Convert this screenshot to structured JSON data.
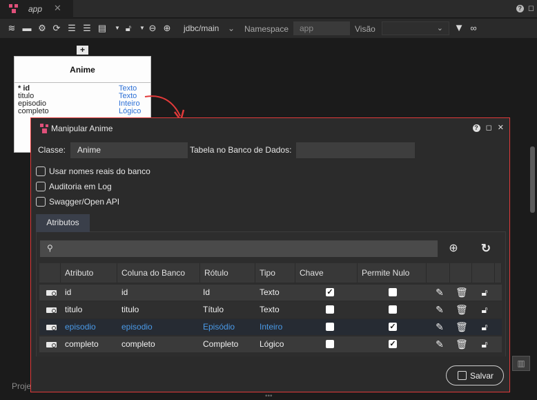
{
  "tab": {
    "label": "app",
    "close": "✕"
  },
  "topright": {
    "help": "?",
    "restore": "◻"
  },
  "toolbar": {
    "connection": "jdbc/main",
    "namespace_label": "Namespace",
    "namespace_value": "app",
    "visao_label": "Visão",
    "visao_value": ""
  },
  "entity": {
    "title": "Anime",
    "fields": [
      {
        "name": "* id",
        "type": "Texto"
      },
      {
        "name": "titulo",
        "type": "Texto"
      },
      {
        "name": "episodio",
        "type": "Inteiro"
      },
      {
        "name": "completo",
        "type": "Lógico"
      }
    ]
  },
  "canvas": {
    "bottom_label": "Proje"
  },
  "dialog": {
    "title": "Manipular Anime",
    "classe_label": "Classe:",
    "classe_value": "Anime",
    "tabela_label": "Tabela no Banco de Dados:",
    "tabela_value": "",
    "options": [
      {
        "label": "Usar nomes reais do banco",
        "checked": false
      },
      {
        "label": "Auditoria em Log",
        "checked": false
      },
      {
        "label": "Swagger/Open API",
        "checked": false
      }
    ],
    "tab_label": "Atributos",
    "search_placeholder": "",
    "columns": [
      "Atributo",
      "Coluna do Banco",
      "Rótulo",
      "Tipo",
      "Chave",
      "Permite Nulo"
    ],
    "rows": [
      {
        "atributo": "id",
        "coluna": "id",
        "rotulo": "Id",
        "tipo": "Texto",
        "chave": true,
        "nulo": false
      },
      {
        "atributo": "titulo",
        "coluna": "titulo",
        "rotulo": "Título",
        "tipo": "Texto",
        "chave": false,
        "nulo": false
      },
      {
        "atributo": "episodio",
        "coluna": "episodio",
        "rotulo": "Episódio",
        "tipo": "Inteiro",
        "chave": false,
        "nulo": true
      },
      {
        "atributo": "completo",
        "coluna": "completo",
        "rotulo": "Completo",
        "tipo": "Lógico",
        "chave": false,
        "nulo": true
      }
    ],
    "save_label": "Salvar"
  },
  "colors": {
    "accent_red": "#e23a3a",
    "link_blue": "#2b6fd6",
    "selected_text": "#4a9ae8"
  }
}
